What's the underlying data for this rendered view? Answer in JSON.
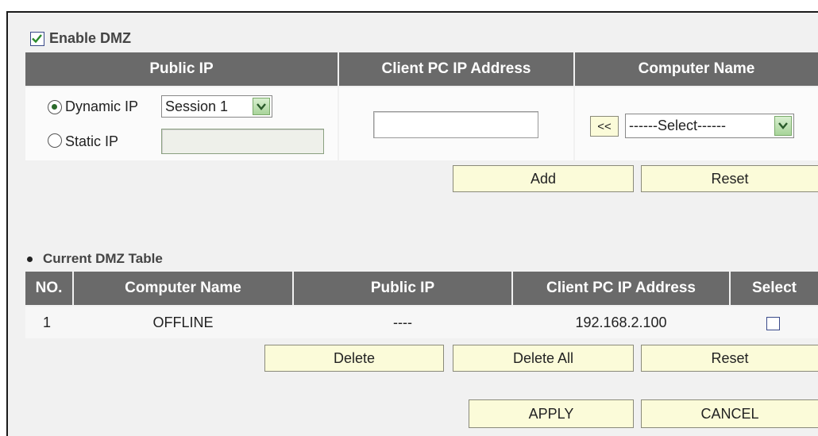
{
  "dmz": {
    "enable_label": "Enable DMZ",
    "enabled": true
  },
  "form": {
    "headers": {
      "public_ip": "Public IP",
      "client_pc_ip": "Client PC IP Address",
      "computer_name": "Computer Name"
    },
    "dynamic_ip_label": "Dynamic IP",
    "static_ip_label": "Static IP",
    "public_ip_mode": "dynamic",
    "session_value": "Session 1",
    "static_ip_value": "",
    "client_ip_value": "",
    "copy_button_label": "<<",
    "computer_select_value": "------Select------",
    "add_button": "Add",
    "reset_button": "Reset"
  },
  "table": {
    "title": "Current DMZ Table",
    "headers": {
      "no": "NO.",
      "computer_name": "Computer Name",
      "public_ip": "Public IP",
      "client_ip": "Client PC IP Address",
      "select": "Select"
    },
    "rows": [
      {
        "no": "1",
        "computer_name": "OFFLINE",
        "public_ip": "----",
        "client_ip": "192.168.2.100",
        "selected": false
      }
    ],
    "delete_button": "Delete",
    "delete_all_button": "Delete All",
    "reset_button": "Reset"
  },
  "actions": {
    "apply": "APPLY",
    "cancel": "CANCEL"
  },
  "colors": {
    "header_bg": "#6a6a6a",
    "button_bg": "#fbfbd9",
    "panel_bg": "#f1f1f1"
  }
}
